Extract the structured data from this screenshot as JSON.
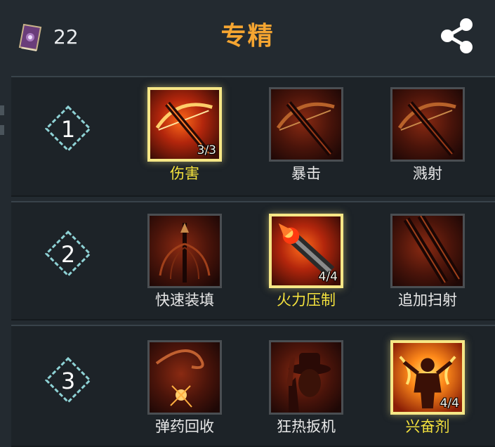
{
  "header": {
    "points": "22",
    "title": "专精",
    "book_icon": "spellbook-icon",
    "share_icon": "share-icon"
  },
  "colors": {
    "background": "#232a30",
    "title": "#f5a531",
    "active_label": "#f5e33e",
    "active_border": "#f6e786",
    "inactive_label": "#e8e8e8",
    "badge": "#8fd3d6"
  },
  "tiers": [
    {
      "number": "1",
      "skills": [
        {
          "label": "伤害",
          "rank": "3/3",
          "active": true,
          "icon": "crossbow-icon"
        },
        {
          "label": "暴击",
          "rank": "",
          "active": false,
          "icon": "crossbow-icon"
        },
        {
          "label": "溅射",
          "rank": "",
          "active": false,
          "icon": "crossbow-icon"
        }
      ]
    },
    {
      "number": "2",
      "skills": [
        {
          "label": "快速装填",
          "rank": "",
          "active": false,
          "icon": "bolts-icon"
        },
        {
          "label": "火力压制",
          "rank": "4/4",
          "active": true,
          "icon": "flaming-barrel-icon"
        },
        {
          "label": "追加扫射",
          "rank": "",
          "active": false,
          "icon": "double-barrel-icon"
        }
      ]
    },
    {
      "number": "3",
      "skills": [
        {
          "label": "弹药回收",
          "rank": "",
          "active": false,
          "icon": "ricochet-icon"
        },
        {
          "label": "狂热扳机",
          "rank": "",
          "active": false,
          "icon": "gunslinger-icon"
        },
        {
          "label": "兴奋剂",
          "rank": "4/4",
          "active": true,
          "icon": "rage-figure-icon"
        }
      ]
    }
  ]
}
